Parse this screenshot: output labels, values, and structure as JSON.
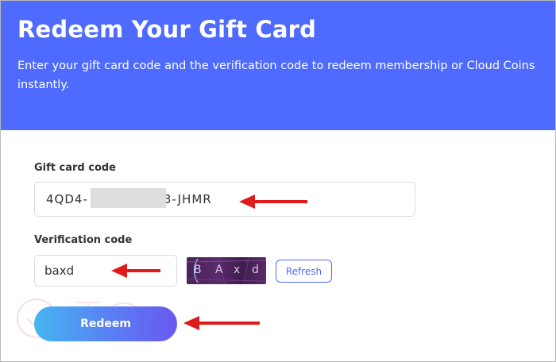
{
  "header": {
    "title": "Redeem Your Gift Card",
    "subtitle": "Enter your gift card code and the verification code to redeem membership or Cloud Coins instantly."
  },
  "form": {
    "gift_label": "Gift card code",
    "gift_value_prefix": "4QD4-",
    "gift_value_suffix": "3-JHMR",
    "verify_label": "Verification code",
    "verify_value": "baxd",
    "captcha_chars": [
      "B",
      "A",
      "x",
      "d"
    ],
    "refresh_label": "Refresh",
    "redeem_label": "Redeem"
  },
  "colors": {
    "header_bg": "#4f6bff",
    "accent": "#4f6bff",
    "annotation_arrow": "#e01b1b"
  },
  "icons": {
    "annotation": "red-arrow-icon",
    "watermark": "watermark-logo-icon"
  }
}
